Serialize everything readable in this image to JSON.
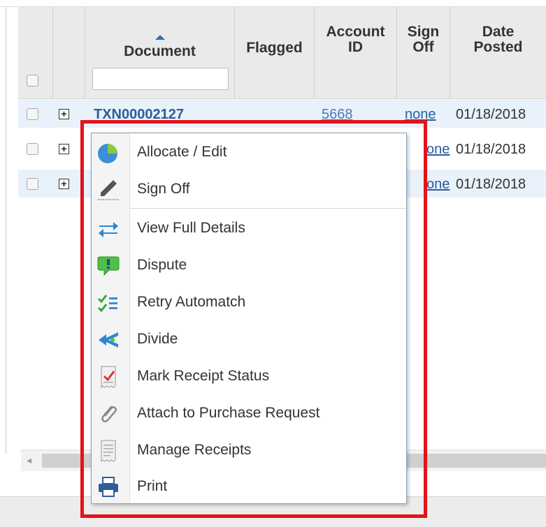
{
  "grid": {
    "columns": {
      "document": "Document",
      "flagged": "Flagged",
      "account_id_line1": "Account",
      "account_id_line2": "ID",
      "sign_off_line1": "Sign",
      "sign_off_line2": "Off",
      "date_posted_line1": "Date",
      "date_posted_line2": "Posted"
    },
    "document_filter_value": "",
    "rows": [
      {
        "document": "TXN00002127",
        "account_id": "5668",
        "sign_off": "none",
        "date_posted": "01/18/2018"
      },
      {
        "sign_off": "none",
        "date_posted": "01/18/2018"
      },
      {
        "sign_off": "none",
        "date_posted": "01/18/2018"
      }
    ],
    "sign_off_partial": "one",
    "scroll_left_glyph": "◂"
  },
  "context_menu": {
    "items": [
      {
        "label": "Allocate / Edit",
        "icon": "pie-chart-icon"
      },
      {
        "label": "Sign Off",
        "icon": "pen-icon"
      },
      {
        "label": "View Full Details",
        "icon": "swap-arrows-icon"
      },
      {
        "label": "Dispute",
        "icon": "exclamation-bubble-icon"
      },
      {
        "label": "Retry Automatch",
        "icon": "checklist-icon"
      },
      {
        "label": "Divide",
        "icon": "split-arrow-icon"
      },
      {
        "label": "Mark Receipt Status",
        "icon": "receipt-check-icon"
      },
      {
        "label": "Attach to Purchase Request",
        "icon": "paperclip-icon"
      },
      {
        "label": "Manage Receipts",
        "icon": "receipt-icon"
      },
      {
        "label": "Print",
        "icon": "printer-icon"
      }
    ]
  },
  "colors": {
    "highlight": "#e3131b",
    "link": "#2a5e9a",
    "header_bg": "#eaeaea",
    "alt_row": "#e9f1fb"
  }
}
